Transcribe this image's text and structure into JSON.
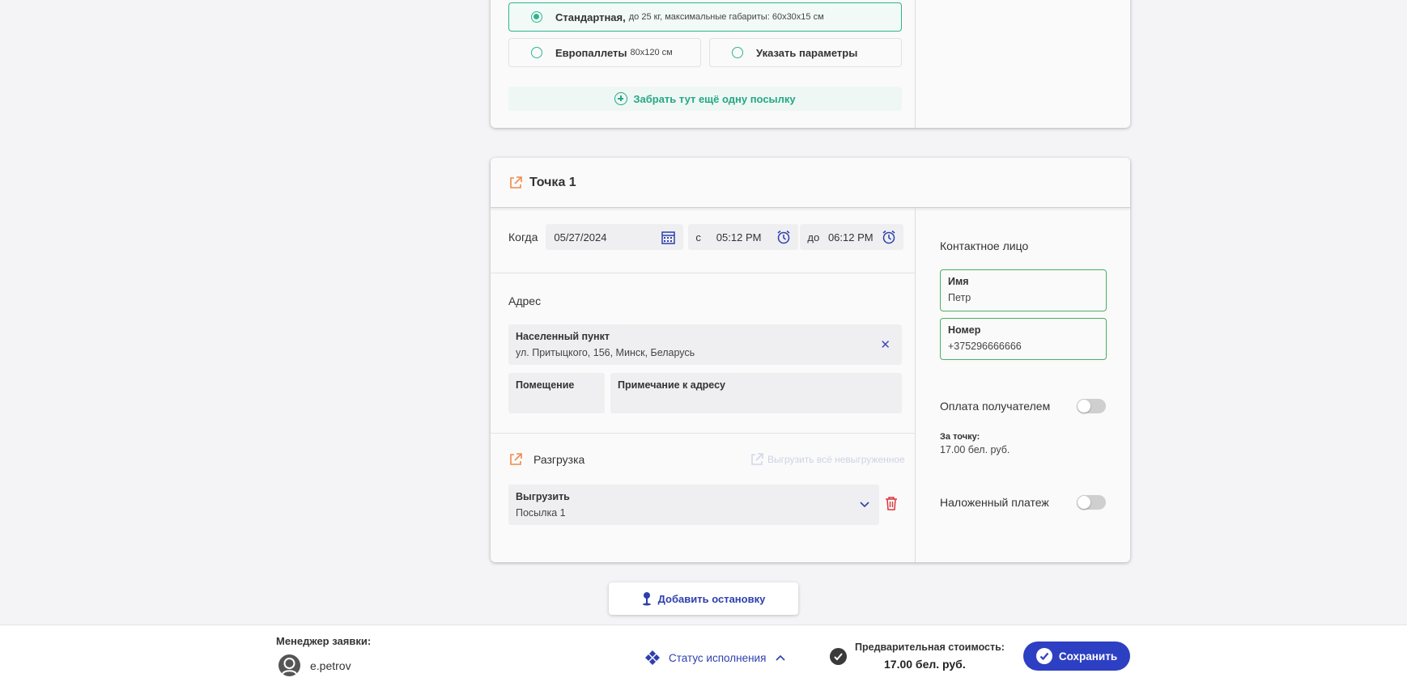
{
  "packages": {
    "standard": {
      "label": "Стандартная,",
      "sub": "до 25 кг, максимальные габариты: 60x30x15 см"
    },
    "euro": {
      "label": "Европаллеты",
      "sub": "80x120 см"
    },
    "custom": {
      "label": "Указать параметры"
    },
    "add_more": "Забрать тут ещё одну посылку"
  },
  "point": {
    "title": "Точка 1",
    "when_label": "Когда",
    "date": "05/27/2024",
    "from_label": "с",
    "time_from": "05:12 PM",
    "to_label": "до",
    "time_to": "06:12 PM",
    "address_label": "Адрес",
    "locality_label": "Населенный пункт",
    "locality_value": "ул. Притыцкого, 156, Минск, Беларусь",
    "clear_glyph": "✕",
    "room_label": "Помещение",
    "note_label": "Примечание к адресу",
    "unload_label": "Разгрузка",
    "unload_all": "Выгрузить всё невыгруженное",
    "unload_field_label": "Выгрузить",
    "unload_field_value": "Посылка 1"
  },
  "contact": {
    "title": "Контактное лицо",
    "name_label": "Имя",
    "name_value": "Петр",
    "phone_label": "Номер",
    "phone_value": "+375296666666",
    "recipient_pay_label": "Оплата получателем",
    "recipient_pay_on": false,
    "per_point_label": "За точку:",
    "per_point_value": "17.00 бел. руб.",
    "cod_label": "Наложенный платеж",
    "cod_on": false
  },
  "add_stop": "Добавить остановку",
  "footer": {
    "manager_label": "Менеджер заявки:",
    "manager_name": "e.petrov",
    "status_label": "Статус исполнения",
    "pre_cost_label": "Предварительная стоимость:",
    "pre_cost_value": "17.00 бел. руб.",
    "save_label": "Сохранить"
  },
  "colors": {
    "accent_green": "#2db58f",
    "accent_blue": "#2d3fc2",
    "icon_orange": "#f08a4b",
    "delete_red": "#d9363e"
  }
}
